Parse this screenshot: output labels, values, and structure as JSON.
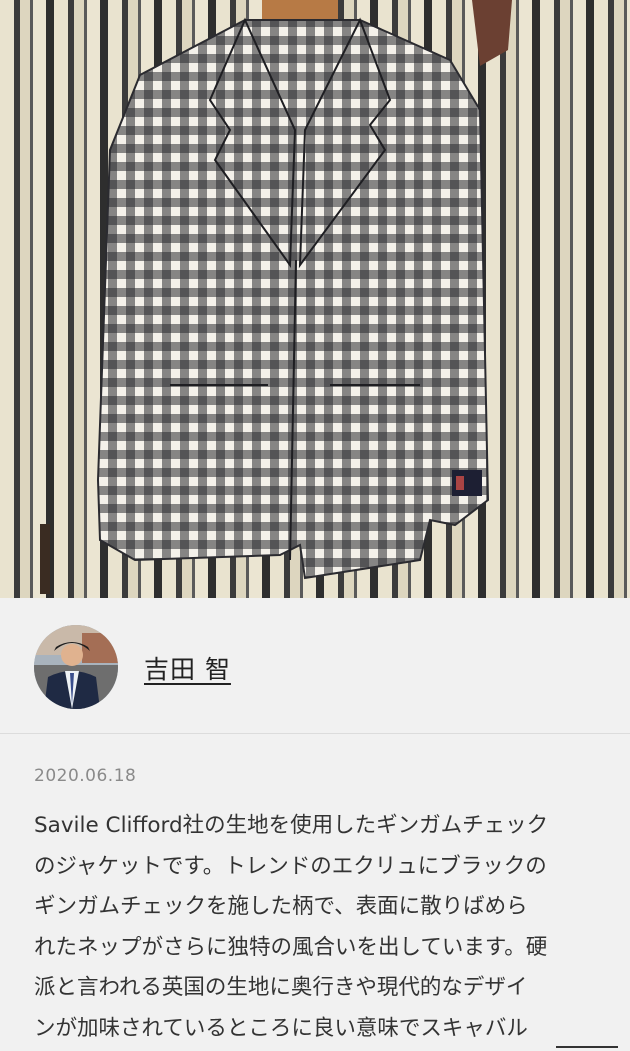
{
  "hero": {
    "image": "gingham-check-jacket-photo"
  },
  "author": {
    "name": "吉田 智",
    "avatar": "author-avatar"
  },
  "post": {
    "date": "2020.06.18",
    "lines": [
      "Savile Clifford社の生地を使用したギンガムチェック",
      "のジャケットです。トレンドのエクリュにブラックの",
      "ギンガムチェックを施した柄で、表面に散りばめら",
      "れたネップがさらに独特の風合いを出しています。硬",
      "派と言われる英国の生地に奥行きや現代的なデザイ",
      "ンが加味されているところに良い意味でスキャバル"
    ]
  },
  "colors": {
    "background": "#f1f1f1",
    "text": "#333333",
    "date": "#8a8a8a"
  }
}
